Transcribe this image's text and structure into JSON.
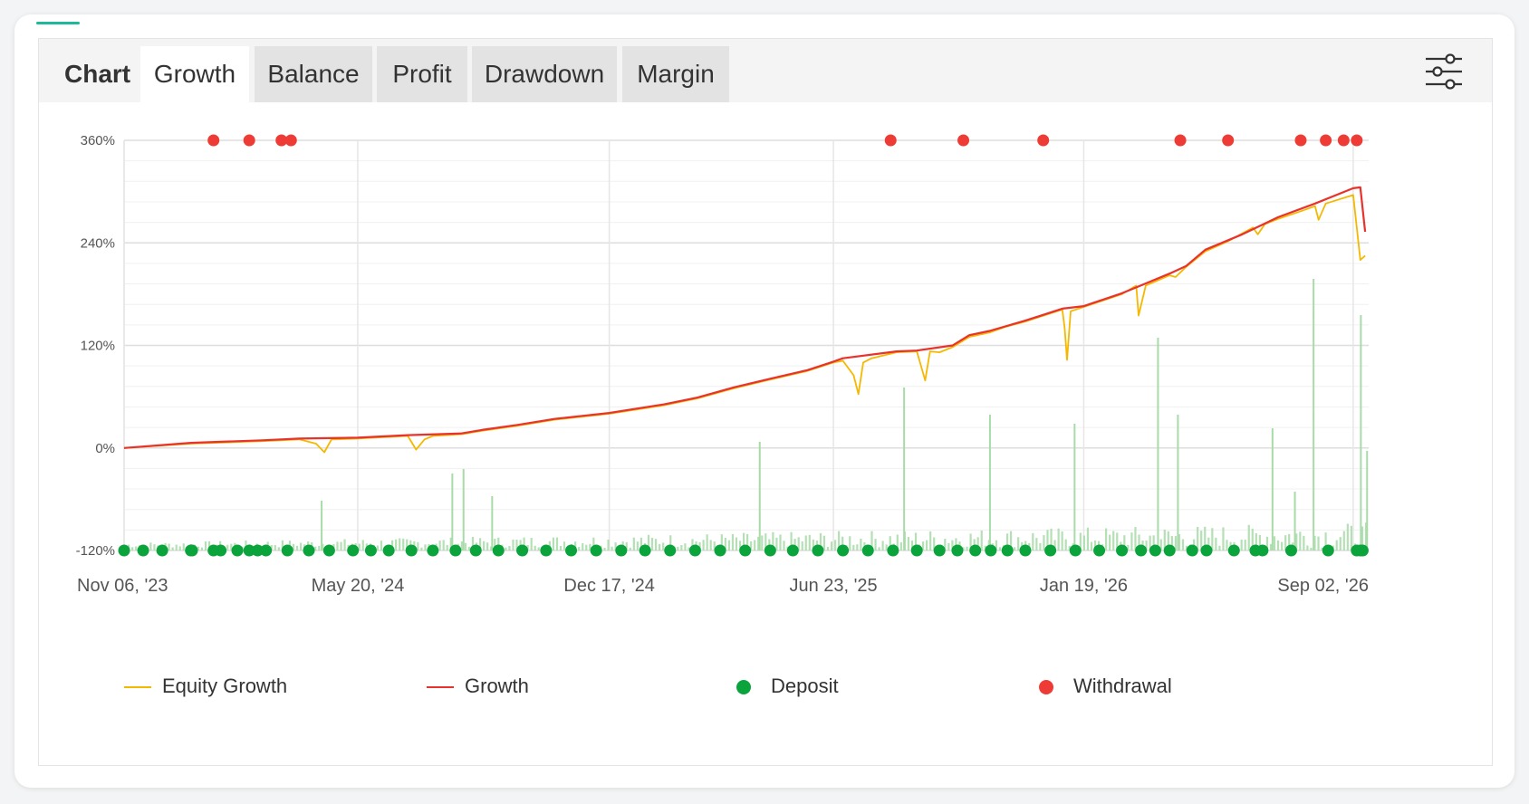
{
  "tabs": {
    "title": "Chart",
    "items": [
      "Growth",
      "Balance",
      "Profit",
      "Drawdown",
      "Margin"
    ],
    "active": "Growth"
  },
  "icons": {
    "settings": "sliders-icon"
  },
  "colors": {
    "equity": "#f5b800",
    "growth": "#e8322c",
    "deposit": "#0aa33c",
    "withdrawal": "#ef3b36",
    "volume": "#a8dba8"
  },
  "chart_data": {
    "type": "line",
    "xlim": [
      "2023-11-06",
      "2026-09-15"
    ],
    "ylim": [
      -120,
      360
    ],
    "yticks": [
      -120,
      0,
      120,
      240,
      360
    ],
    "ytick_labels": [
      "-120%",
      "0%",
      "120%",
      "240%",
      "360%"
    ],
    "xticks": [
      "2023-11-06",
      "2024-05-20",
      "2024-12-17",
      "2025-06-23",
      "2026-01-19",
      "2026-09-02"
    ],
    "xtick_labels": [
      "Nov 06, '23",
      "May 20, '24",
      "Dec 17, '24",
      "Jun 23, '25",
      "Jan 19, '26",
      "Sep 02, '26"
    ],
    "grid": true,
    "legend_position": "bottom",
    "series": [
      {
        "name": "Equity Growth",
        "x": [
          "2023-11-06",
          "2024-01-01",
          "2024-03-01",
          "2024-04-01",
          "2024-04-15",
          "2024-04-22",
          "2024-04-28",
          "2024-05-20",
          "2024-07-01",
          "2024-07-08",
          "2024-07-15",
          "2024-07-22",
          "2024-08-15",
          "2024-09-01",
          "2024-10-01",
          "2024-11-01",
          "2024-12-17",
          "2025-02-01",
          "2025-03-01",
          "2025-04-01",
          "2025-05-01",
          "2025-06-01",
          "2025-06-23",
          "2025-07-01",
          "2025-07-10",
          "2025-07-14",
          "2025-07-18",
          "2025-07-25",
          "2025-08-15",
          "2025-09-01",
          "2025-09-08",
          "2025-09-12",
          "2025-09-20",
          "2025-10-01",
          "2025-10-15",
          "2025-11-01",
          "2025-11-15",
          "2025-12-01",
          "2026-01-01",
          "2026-01-03",
          "2026-01-05",
          "2026-01-08",
          "2026-01-19",
          "2026-02-20",
          "2026-03-04",
          "2026-03-06",
          "2026-03-12",
          "2026-04-01",
          "2026-04-06",
          "2026-04-15",
          "2026-05-01",
          "2026-05-20",
          "2026-06-10",
          "2026-06-14",
          "2026-06-20",
          "2026-07-01",
          "2026-07-20",
          "2026-08-01",
          "2026-08-04",
          "2026-08-10",
          "2026-09-02",
          "2026-09-08",
          "2026-09-12"
        ],
        "values": [
          0,
          5,
          8,
          10,
          5,
          -5,
          10,
          11,
          14,
          -2,
          10,
          14,
          16,
          20,
          26,
          33,
          40,
          50,
          58,
          70,
          80,
          90,
          100,
          102,
          85,
          63,
          100,
          105,
          112,
          113,
          79,
          113,
          112,
          118,
          130,
          135,
          142,
          148,
          162,
          140,
          103,
          160,
          165,
          180,
          190,
          155,
          190,
          202,
          200,
          212,
          230,
          242,
          258,
          250,
          262,
          268,
          277,
          283,
          267,
          286,
          296,
          220,
          225
        ]
      },
      {
        "name": "Growth",
        "x": [
          "2023-11-06",
          "2024-01-01",
          "2024-03-01",
          "2024-04-01",
          "2024-05-20",
          "2024-07-01",
          "2024-08-15",
          "2024-09-01",
          "2024-10-01",
          "2024-11-01",
          "2024-12-17",
          "2025-02-01",
          "2025-03-01",
          "2025-04-01",
          "2025-05-01",
          "2025-06-01",
          "2025-06-23",
          "2025-07-01",
          "2025-08-15",
          "2025-09-01",
          "2025-10-01",
          "2025-10-15",
          "2025-11-01",
          "2025-12-01",
          "2026-01-01",
          "2026-01-19",
          "2026-02-20",
          "2026-04-01",
          "2026-04-15",
          "2026-05-01",
          "2026-06-01",
          "2026-07-01",
          "2026-08-01",
          "2026-09-02",
          "2026-09-08",
          "2026-09-12"
        ],
        "values": [
          0,
          6,
          9,
          11,
          12,
          15,
          17,
          21,
          27,
          34,
          41,
          51,
          59,
          71,
          81,
          91,
          101,
          105,
          113,
          114,
          120,
          132,
          137,
          149,
          163,
          166,
          181,
          204,
          213,
          232,
          250,
          270,
          286,
          304,
          305,
          253
        ]
      }
    ],
    "deposits": [
      "2023-11-06",
      "2023-11-22",
      "2023-12-08",
      "2024-01-01",
      "2024-01-02",
      "2024-01-20",
      "2024-01-26",
      "2024-02-09",
      "2024-02-19",
      "2024-02-26",
      "2024-03-04",
      "2024-03-22",
      "2024-04-09",
      "2024-04-26",
      "2024-05-16",
      "2024-05-31",
      "2024-06-15",
      "2024-07-04",
      "2024-07-22",
      "2024-08-10",
      "2024-08-27",
      "2024-09-15",
      "2024-10-05",
      "2024-10-25",
      "2024-11-15",
      "2024-12-06",
      "2024-12-27",
      "2025-01-16",
      "2025-02-06",
      "2025-02-27",
      "2025-03-20",
      "2025-04-10",
      "2025-05-01",
      "2025-05-20",
      "2025-06-10",
      "2025-07-01",
      "2025-07-22",
      "2025-08-12",
      "2025-09-01",
      "2025-09-20",
      "2025-10-05",
      "2025-10-20",
      "2025-11-02",
      "2025-11-16",
      "2025-12-01",
      "2025-12-22",
      "2026-01-12",
      "2026-02-01",
      "2026-02-20",
      "2026-03-08",
      "2026-03-20",
      "2026-04-01",
      "2026-04-20",
      "2026-05-02",
      "2026-05-25",
      "2026-06-12",
      "2026-06-18",
      "2026-07-12",
      "2026-08-12",
      "2026-09-05",
      "2026-09-08",
      "2026-09-10"
    ],
    "withdrawals": [
      "2024-01-20",
      "2024-02-19",
      "2024-03-17",
      "2024-03-25",
      "2025-08-10",
      "2025-10-10",
      "2025-12-16",
      "2026-04-10",
      "2026-05-20",
      "2026-07-20",
      "2026-08-10",
      "2026-08-25",
      "2026-09-05"
    ]
  },
  "legend": {
    "equity": "Equity Growth",
    "growth": "Growth",
    "deposit": "Deposit",
    "withdrawal": "Withdrawal"
  }
}
